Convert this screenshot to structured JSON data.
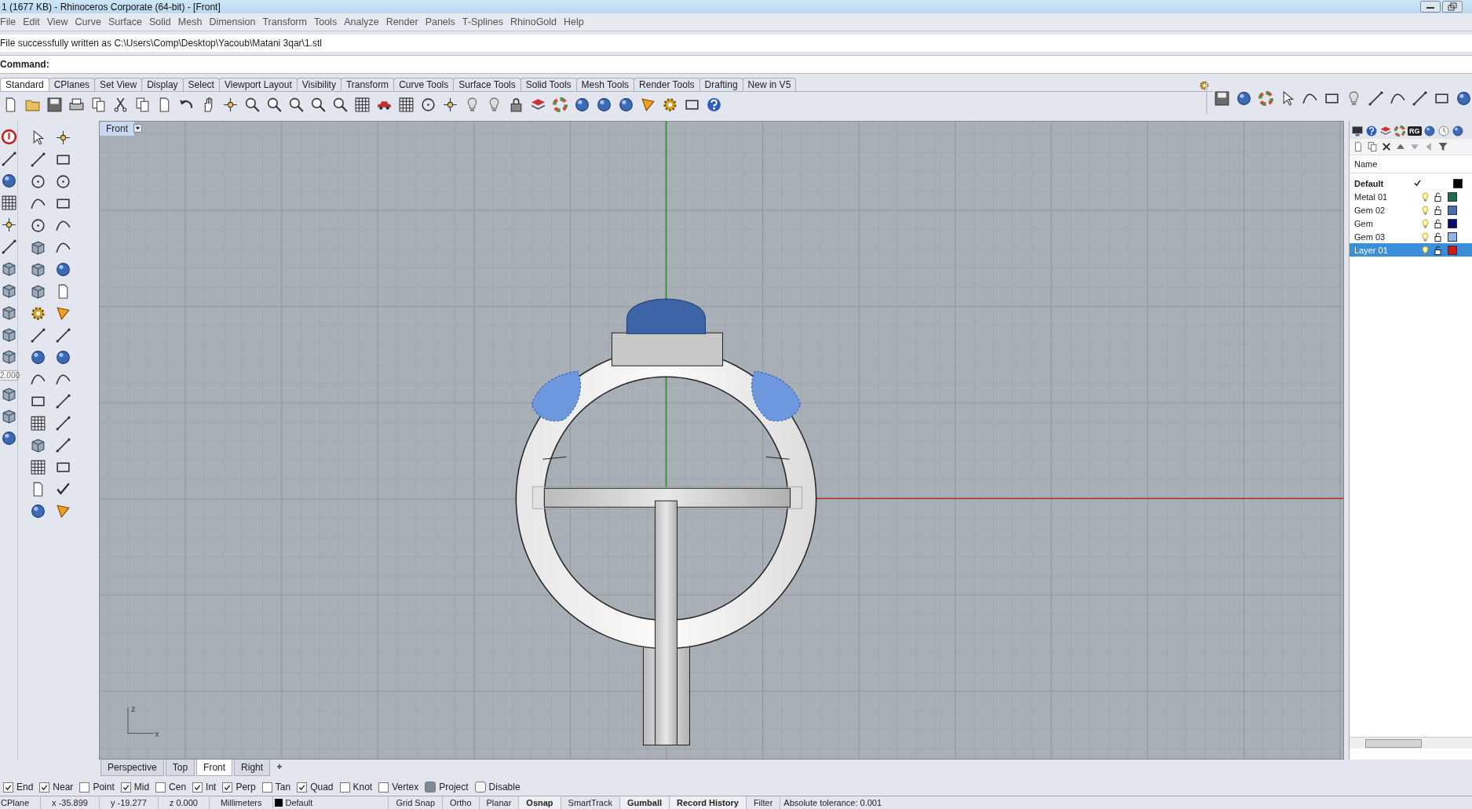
{
  "window": {
    "title": "1 (1677 KB) - Rhinoceros Corporate (64-bit) - [Front]"
  },
  "menu": [
    "File",
    "Edit",
    "View",
    "Curve",
    "Surface",
    "Solid",
    "Mesh",
    "Dimension",
    "Transform",
    "Tools",
    "Analyze",
    "Render",
    "Panels",
    "T-Splines",
    "RhinoGold",
    "Help"
  ],
  "command_history": "File successfully written as C:\\Users\\Comp\\Desktop\\Yacoub\\Matani 3qar\\1.stl",
  "command_prompt": "Command:",
  "toolbar_tabs": [
    {
      "label": "Standard",
      "selected": true
    },
    {
      "label": "CPlanes",
      "selected": false
    },
    {
      "label": "Set View",
      "selected": false
    },
    {
      "label": "Display",
      "selected": false
    },
    {
      "label": "Select",
      "selected": false
    },
    {
      "label": "Viewport Layout",
      "selected": false
    },
    {
      "label": "Visibility",
      "selected": false
    },
    {
      "label": "Transform",
      "selected": false
    },
    {
      "label": "Curve Tools",
      "selected": false
    },
    {
      "label": "Surface Tools",
      "selected": false
    },
    {
      "label": "Solid Tools",
      "selected": false
    },
    {
      "label": "Mesh Tools",
      "selected": false
    },
    {
      "label": "Render Tools",
      "selected": false
    },
    {
      "label": "Drafting",
      "selected": false
    },
    {
      "label": "New in V5",
      "selected": false
    }
  ],
  "left_toolbar": {
    "field_value": "2.000"
  },
  "viewport": {
    "title": "Front",
    "axis_labels": [
      "z",
      "x"
    ]
  },
  "viewport_tabs": [
    {
      "label": "Perspective",
      "selected": false
    },
    {
      "label": "Top",
      "selected": false
    },
    {
      "label": "Front",
      "selected": true
    },
    {
      "label": "Right",
      "selected": false
    }
  ],
  "layers_panel": {
    "tab_label": "RG",
    "column": "Name",
    "layers": [
      {
        "name": "Default",
        "current": true,
        "selected": false,
        "color": "#000000"
      },
      {
        "name": "Metal 01",
        "current": false,
        "selected": false,
        "color": "#1e6e4e"
      },
      {
        "name": "Gem 02",
        "current": false,
        "selected": false,
        "color": "#4a6fb0"
      },
      {
        "name": "Gem",
        "current": false,
        "selected": false,
        "color": "#0a0a70"
      },
      {
        "name": "Gem 03",
        "current": false,
        "selected": false,
        "color": "#8cb4e6"
      },
      {
        "name": "Layer 01",
        "current": false,
        "selected": true,
        "color": "#d01818"
      }
    ]
  },
  "osnaps": [
    {
      "label": "End",
      "kind": "checkbox",
      "checked": true
    },
    {
      "label": "Near",
      "kind": "checkbox",
      "checked": true
    },
    {
      "label": "Point",
      "kind": "checkbox",
      "checked": false
    },
    {
      "label": "Mid",
      "kind": "checkbox",
      "checked": true
    },
    {
      "label": "Cen",
      "kind": "checkbox",
      "checked": false
    },
    {
      "label": "Int",
      "kind": "checkbox",
      "checked": true
    },
    {
      "label": "Perp",
      "kind": "checkbox",
      "checked": true
    },
    {
      "label": "Tan",
      "kind": "checkbox",
      "checked": false
    },
    {
      "label": "Quad",
      "kind": "checkbox",
      "checked": true
    },
    {
      "label": "Knot",
      "kind": "checkbox",
      "checked": false
    },
    {
      "label": "Vertex",
      "kind": "checkbox",
      "checked": false
    },
    {
      "label": "Project",
      "kind": "toggle",
      "checked": true
    },
    {
      "label": "Disable",
      "kind": "toggle",
      "checked": false
    }
  ],
  "status_bar": {
    "fields": [
      "CPlane",
      "x -35.899",
      "y -19.277",
      "z 0.000",
      "Millimeters"
    ],
    "layer": {
      "name": "Default",
      "color": "#000000"
    },
    "toggles": [
      {
        "label": "Grid Snap",
        "on": false
      },
      {
        "label": "Ortho",
        "on": false
      },
      {
        "label": "Planar",
        "on": false
      },
      {
        "label": "Osnap",
        "on": true
      },
      {
        "label": "SmartTrack",
        "on": false
      },
      {
        "label": "Gumball",
        "on": true
      },
      {
        "label": "Record History",
        "on": true
      },
      {
        "label": "Filter",
        "on": false
      }
    ],
    "tolerance": "Absolute tolerance: 0.001"
  }
}
